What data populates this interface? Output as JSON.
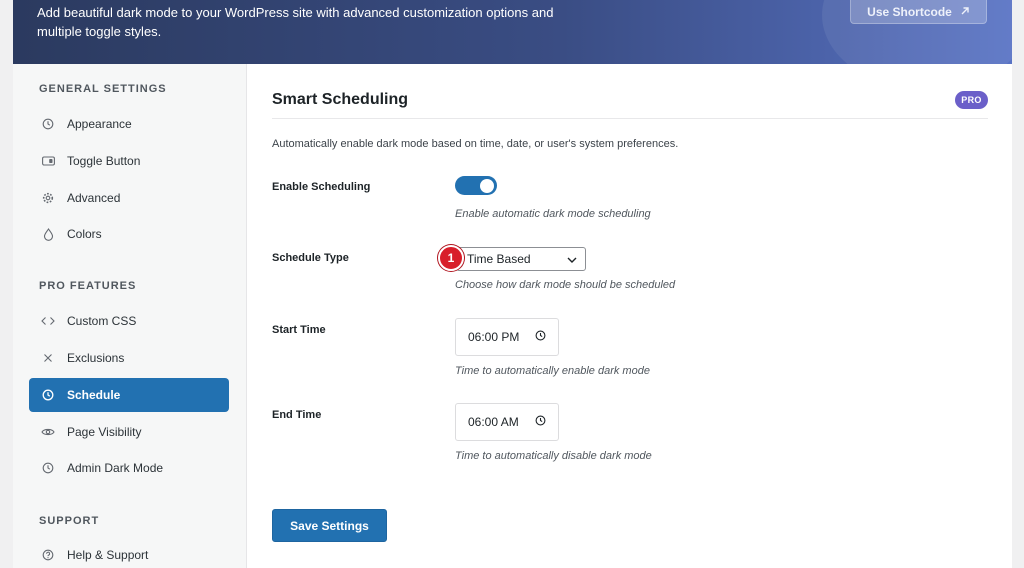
{
  "banner": {
    "description": "Add beautiful dark mode to your WordPress site with advanced customization options and multiple toggle styles.",
    "shortcut_label": "Use Shortcode",
    "shortcut_icon": "arrow-up-right-icon"
  },
  "sidebar": {
    "general_label": "GENERAL SETTINGS",
    "general_items": [
      {
        "label": "Appearance",
        "icon": "clock-icon"
      },
      {
        "label": "Toggle Button",
        "icon": "toggle-icon"
      },
      {
        "label": "Advanced",
        "icon": "gear-icon"
      },
      {
        "label": "Colors",
        "icon": "droplet-icon"
      }
    ],
    "pro_label": "PRO FEATURES",
    "pro_items": [
      {
        "label": "Custom CSS",
        "icon": "code-icon"
      },
      {
        "label": "Exclusions",
        "icon": "close-icon"
      },
      {
        "label": "Schedule",
        "icon": "clock-icon",
        "active": true
      },
      {
        "label": "Page Visibility",
        "icon": "eye-icon"
      },
      {
        "label": "Admin Dark Mode",
        "icon": "clock-icon"
      }
    ],
    "support_label": "SUPPORT",
    "support_items": [
      {
        "label": "Help & Support",
        "icon": "help-icon"
      }
    ]
  },
  "main": {
    "title": "Smart Scheduling",
    "badge": "PRO",
    "description": "Automatically enable dark mode based on time, date, or user's system preferences.",
    "enable": {
      "label": "Enable Scheduling",
      "help": "Enable automatic dark mode scheduling",
      "checked": true
    },
    "schedule_type": {
      "label": "Schedule Type",
      "value": "Time Based",
      "help": "Choose how dark mode should be scheduled",
      "marker": "1"
    },
    "start_time": {
      "label": "Start Time",
      "value": "06:00 PM",
      "help": "Time to automatically enable dark mode"
    },
    "end_time": {
      "label": "End Time",
      "value": "06:00 AM",
      "help": "Time to automatically disable dark mode"
    },
    "save_label": "Save Settings"
  },
  "colors": {
    "accent": "#2271b1",
    "badge": "#6b5fc9",
    "marker": "#d81e2a"
  }
}
